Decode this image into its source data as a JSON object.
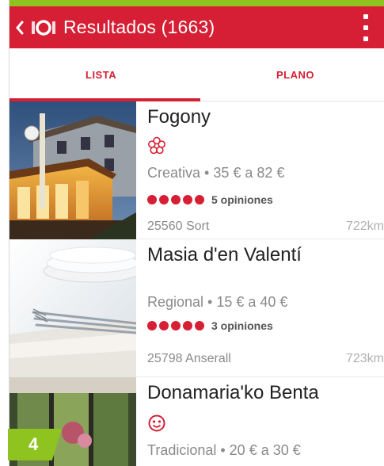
{
  "appbar": {
    "title": "Resultados (1663)",
    "back_icon": "chevron-left-icon",
    "logo_icon": "guide-logo-icon",
    "menu_icon": "overflow-menu-icon",
    "color": "#d61f34"
  },
  "tabs": [
    {
      "label": "LISTA",
      "active": true
    },
    {
      "label": "PLANO",
      "active": false
    }
  ],
  "restaurants": [
    {
      "name": "Fogony",
      "distinction_icon": "michelin-star-icon",
      "meta": "Creativa • 35 € a 82 €",
      "rating_dots": 5,
      "reviews": "5 opiniones",
      "location": "25560 Sort",
      "distance": "722km"
    },
    {
      "name": "Masia d'en Valentí",
      "distinction_icon": "",
      "meta": "Regional • 15 € a 40 €",
      "rating_dots": 5,
      "reviews": "3 opiniones",
      "location": "25798 Anserall",
      "distance": "723km"
    },
    {
      "name": "Donamaria'ko Benta",
      "distinction_icon": "bib-gourmand-icon",
      "meta": "Tradicional • 20 € a 30 €"
    }
  ],
  "badge": {
    "label": "4",
    "color": "#8fc31f"
  }
}
